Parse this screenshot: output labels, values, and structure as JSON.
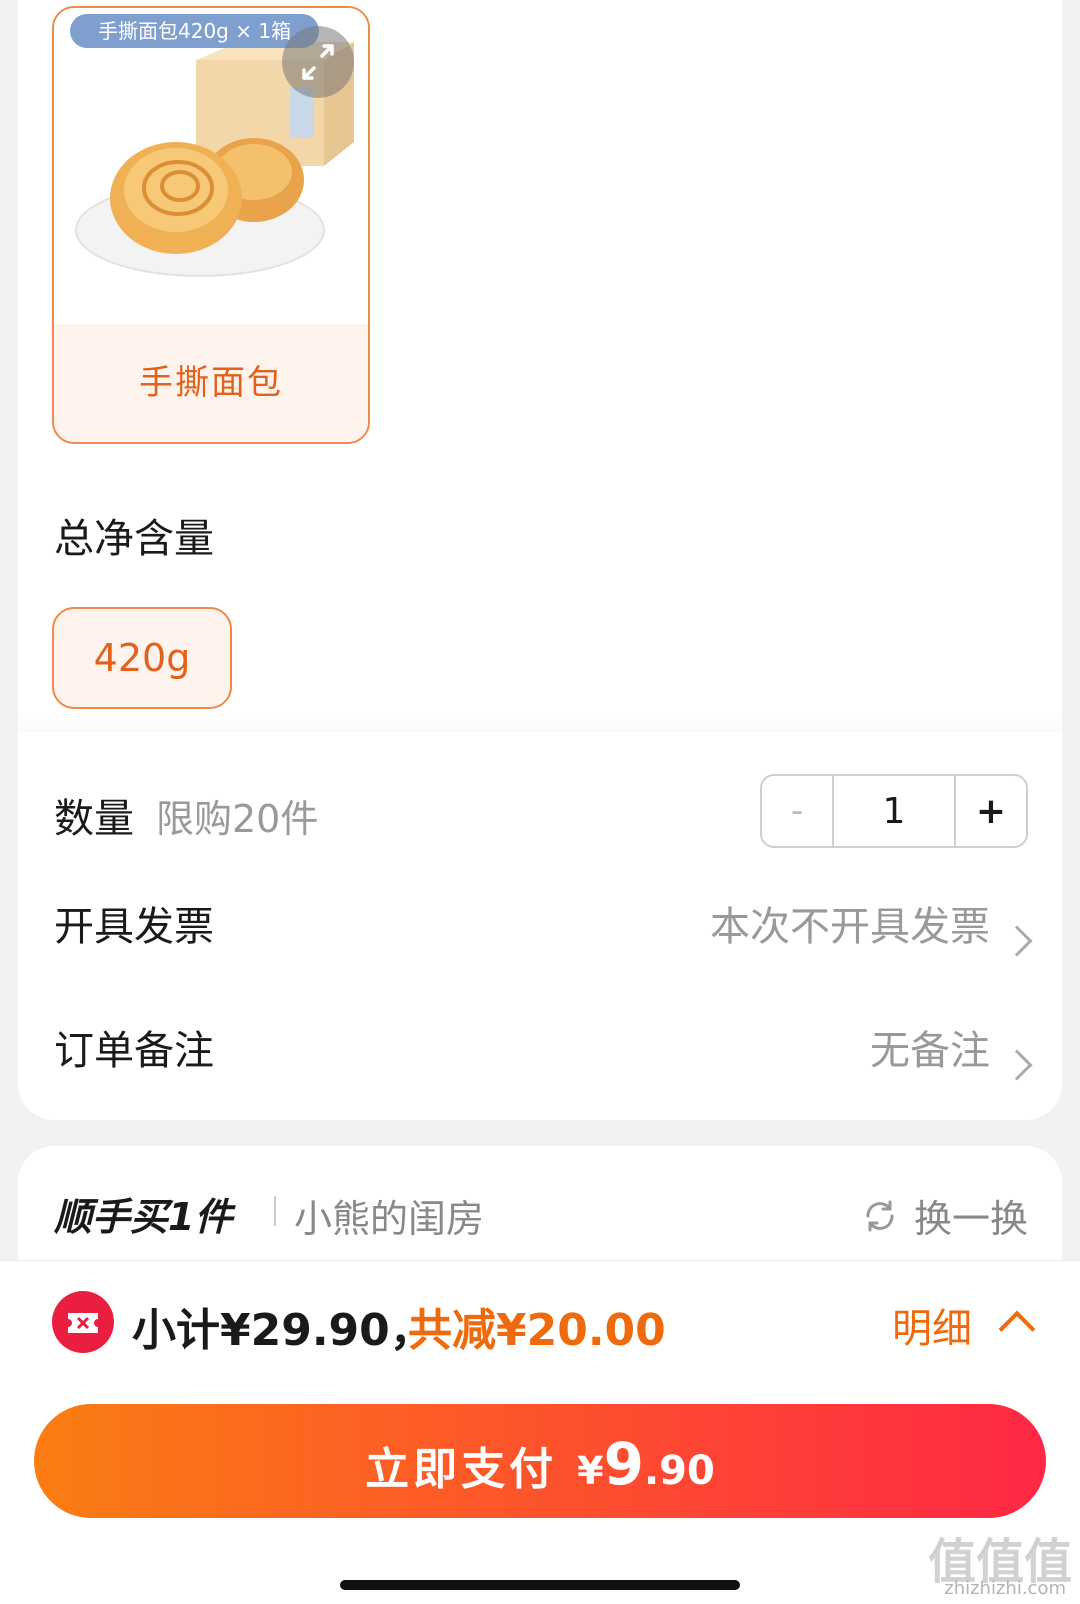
{
  "spec_option": {
    "tag": "手撕面包420g × 1箱",
    "name": "手撕面包"
  },
  "net_weight": {
    "title": "总净含量",
    "option": "420g"
  },
  "quantity": {
    "label": "数量",
    "limit": "限购20件",
    "minus": "-",
    "value": "1",
    "plus": "+"
  },
  "invoice": {
    "label": "开具发票",
    "value": "本次不开具发票"
  },
  "remark": {
    "label": "订单备注",
    "value": "无备注"
  },
  "recommend": {
    "title": "顺手买1件",
    "shop": "小熊的闺房",
    "swap": "换一换"
  },
  "summary": {
    "subtotal": "小计¥29.90，",
    "discount": "共减¥20.00",
    "detail": "明细"
  },
  "pay": {
    "label": "立即支付",
    "currency": "¥",
    "amount_int": "9",
    "amount_dec": ".90"
  },
  "watermark": {
    "logo": "值值值",
    "url": "zhizhizhi.com"
  },
  "colors": {
    "accent": "#e0621c",
    "price": "#ee6a0c",
    "pay_start": "#fa7d12",
    "pay_end": "#ff2845"
  }
}
